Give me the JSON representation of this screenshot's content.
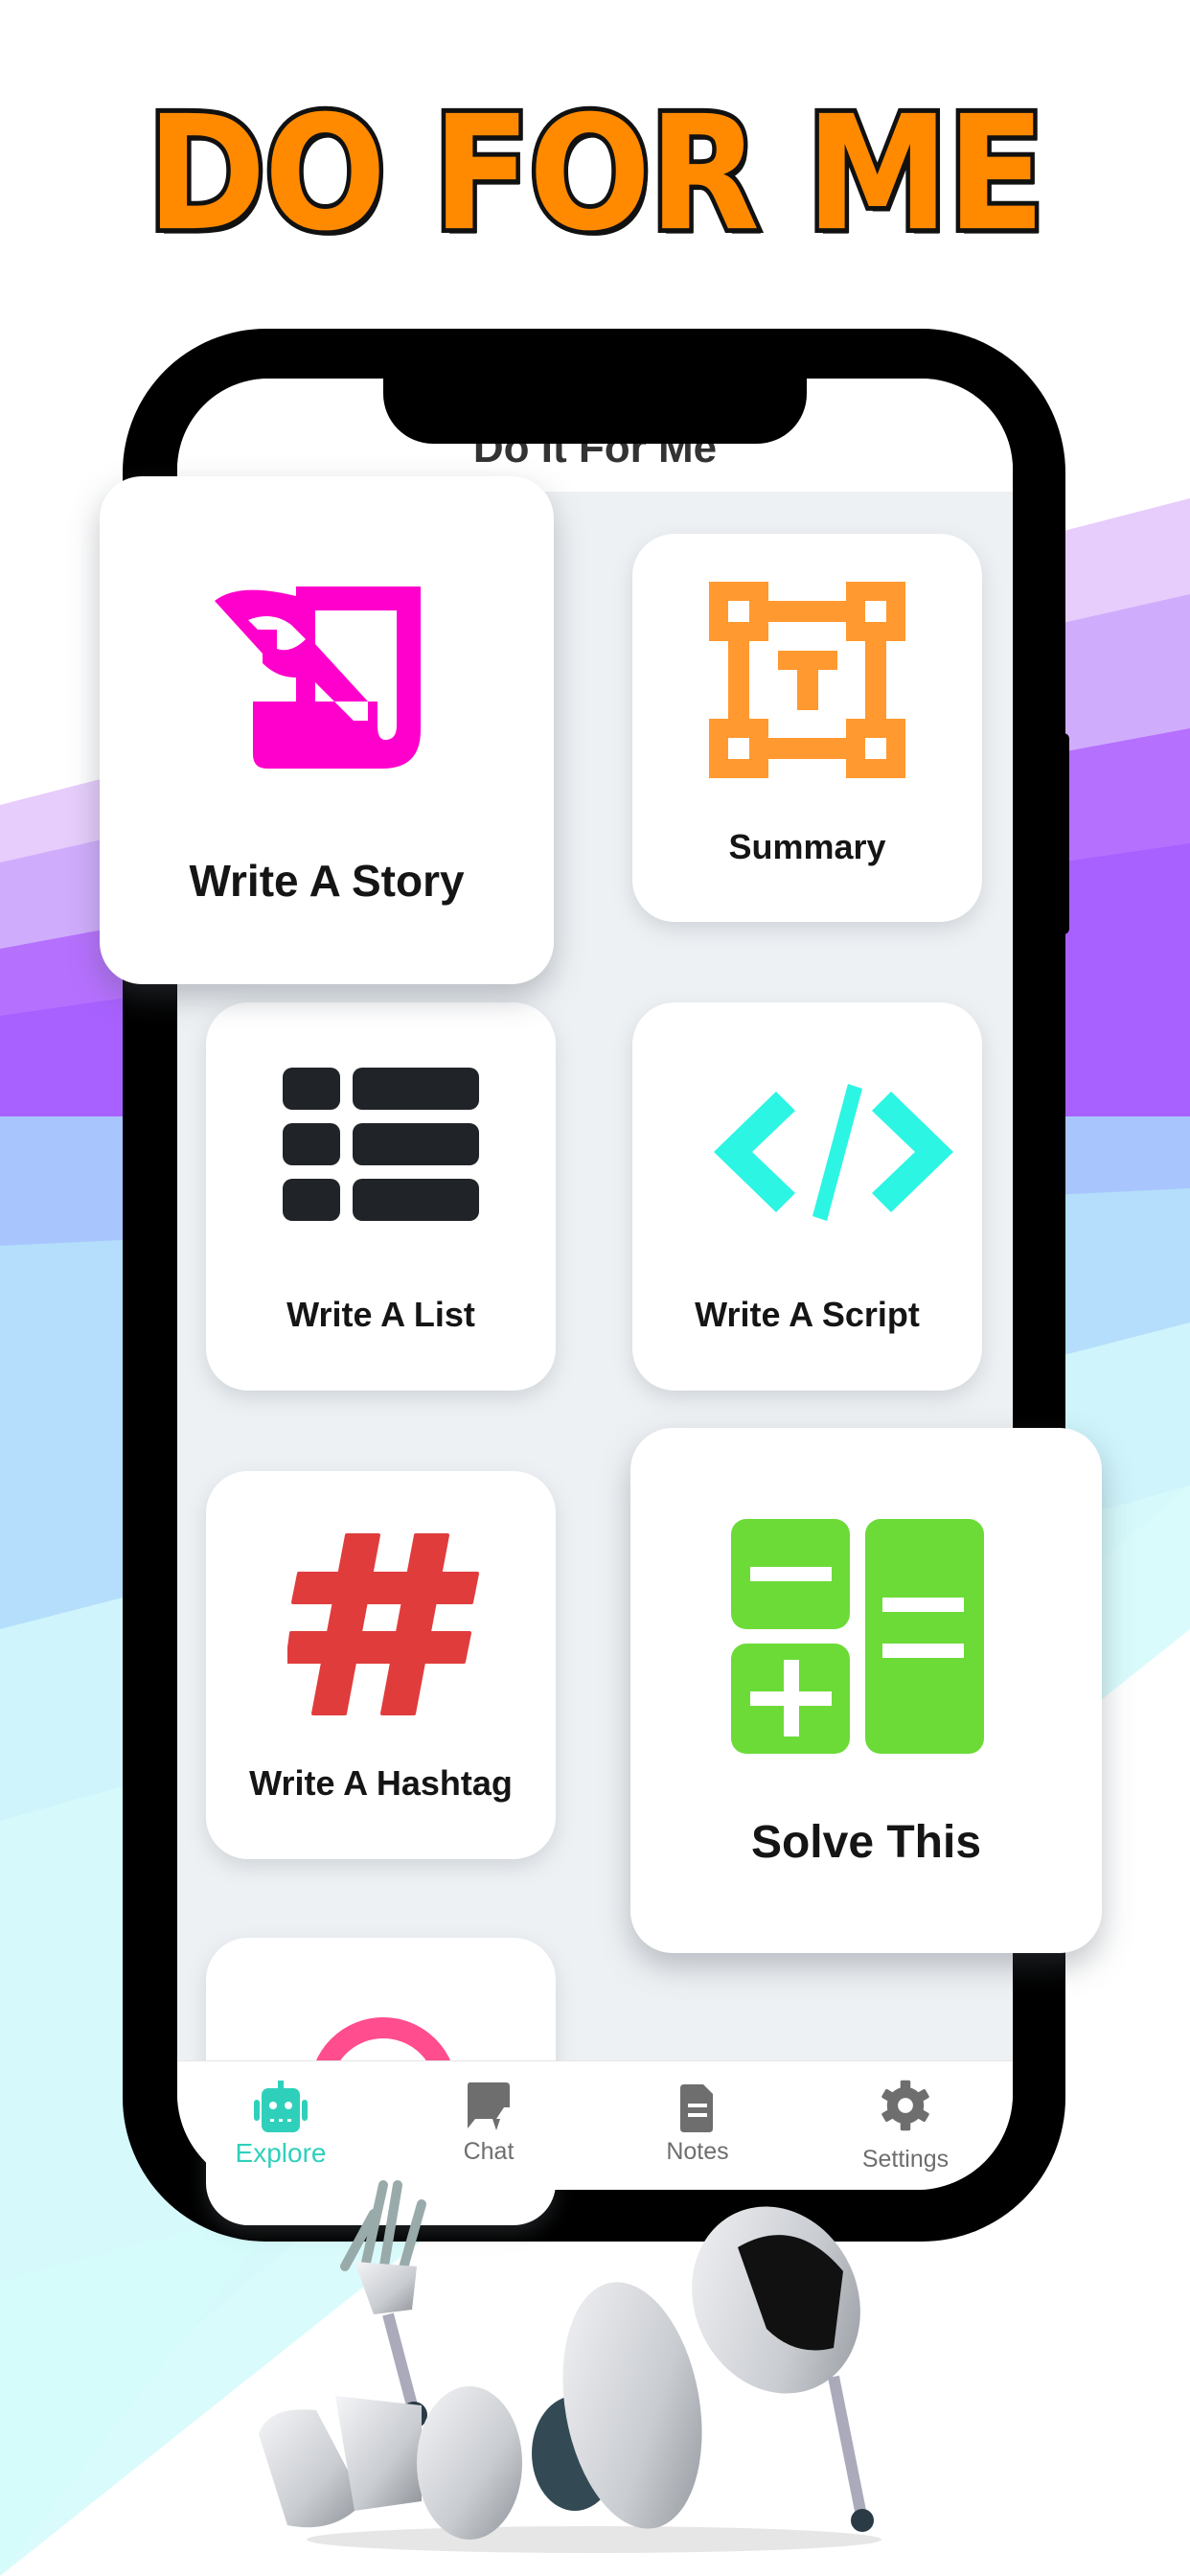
{
  "headline": "DO FOR ME",
  "app": {
    "title": "Do It For Me"
  },
  "colors": {
    "headline_fill": "#ff8a00",
    "accent": "#2fd0bb",
    "story_icon": "#ff00cc",
    "summary_icon": "#ff9930",
    "list_icon": "#202428",
    "script_icon": "#2cf5e3",
    "hashtag_icon": "#e03c3c",
    "solve_icon": "#6cdb38",
    "partial_icon": "#ff4d8d",
    "tab_inactive": "#6e6e6e"
  },
  "cards": [
    {
      "label": "Write A Story",
      "icon": "quill-scroll-icon"
    },
    {
      "label": "Summary",
      "icon": "text-frame-icon"
    },
    {
      "label": "Write A List",
      "icon": "list-icon"
    },
    {
      "label": "Write A Script",
      "icon": "code-icon"
    },
    {
      "label": "Write A Hashtag",
      "icon": "hashtag-icon"
    },
    {
      "label": "Solve This",
      "icon": "calculator-icon"
    },
    {
      "label": "",
      "icon": "ring-icon"
    }
  ],
  "tabs": [
    {
      "label": "Explore",
      "icon": "robot-icon",
      "active": true
    },
    {
      "label": "Chat",
      "icon": "chat-bolt-icon",
      "active": false
    },
    {
      "label": "Notes",
      "icon": "note-icon",
      "active": false
    },
    {
      "label": "Settings",
      "icon": "gear-icon",
      "active": false
    }
  ]
}
